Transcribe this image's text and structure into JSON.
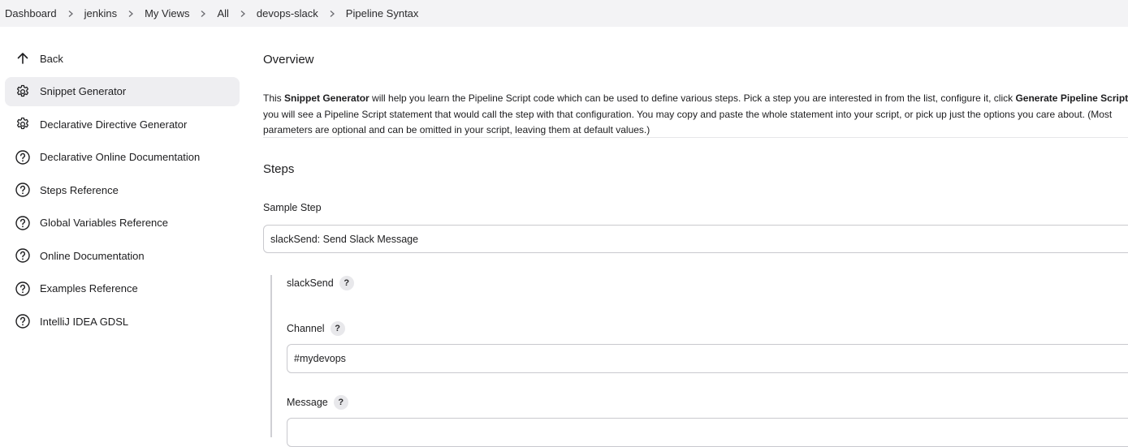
{
  "breadcrumb": {
    "items": [
      {
        "label": "Dashboard"
      },
      {
        "label": "jenkins"
      },
      {
        "label": "My Views"
      },
      {
        "label": "All"
      },
      {
        "label": "devops-slack"
      },
      {
        "label": "Pipeline Syntax"
      }
    ]
  },
  "sidebar": {
    "items": [
      {
        "label": "Back",
        "icon": "arrow-up-icon"
      },
      {
        "label": "Snippet Generator",
        "icon": "gear-icon",
        "active": true
      },
      {
        "label": "Declarative Directive Generator",
        "icon": "gear-icon"
      },
      {
        "label": "Declarative Online Documentation",
        "icon": "help-circle-icon"
      },
      {
        "label": "Steps Reference",
        "icon": "help-circle-icon"
      },
      {
        "label": "Global Variables Reference",
        "icon": "help-circle-icon"
      },
      {
        "label": "Online Documentation",
        "icon": "help-circle-icon"
      },
      {
        "label": "Examples Reference",
        "icon": "help-circle-icon"
      },
      {
        "label": "IntelliJ IDEA GDSL",
        "icon": "help-circle-icon"
      }
    ]
  },
  "overview": {
    "heading": "Overview",
    "text_1": "This ",
    "bold_1": "Snippet Generator",
    "text_2": " will help you learn the Pipeline Script code which can be used to define various steps. Pick a step you are interested in from the list, configure it, click ",
    "bold_2": "Generate Pipeline Script",
    "text_3": ", and you will see a Pipeline Script statement that would call the step with that configuration. You may copy and paste the whole statement into your script, or pick up just the options you care about. (Most parameters are optional and can be omitted in your script, leaving them at default values.)"
  },
  "steps": {
    "heading": "Steps",
    "sample_step_label": "Sample Step",
    "sample_step_value": "slackSend: Send Slack Message",
    "step_name": "slackSend",
    "help_symbol": "?",
    "channel_label": "Channel",
    "channel_value": "#mydevops",
    "message_label": "Message"
  },
  "colors": {
    "breadcrumb_bg": "#f3f3f5",
    "active_item_bg": "#eeeef1",
    "border": "#c9c9ce"
  }
}
